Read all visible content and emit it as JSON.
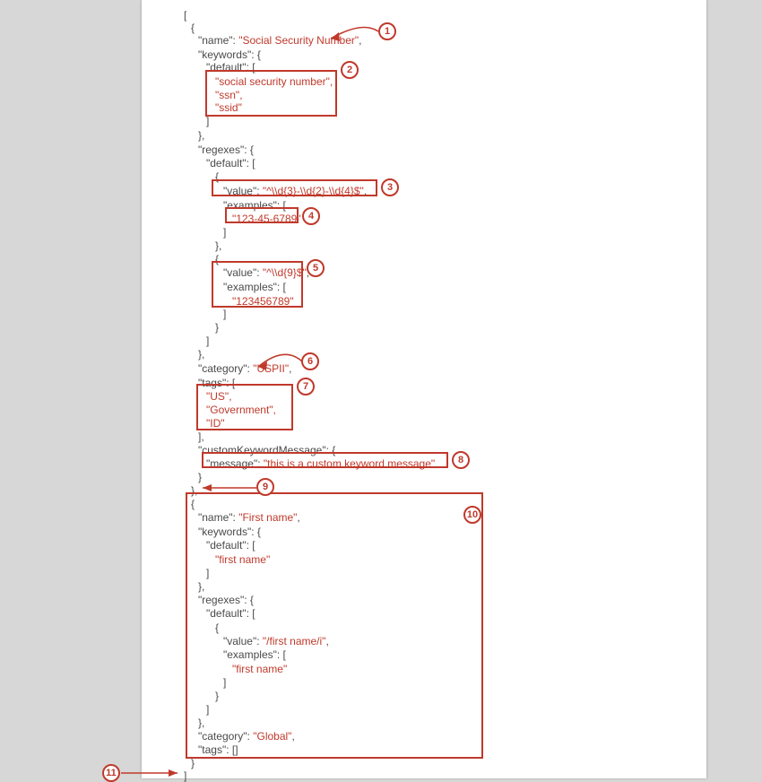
{
  "code": {
    "l1": "[",
    "l2": "{",
    "l3a": "\"name\"",
    "l3b": ": ",
    "l3c": "\"Social Security Number\"",
    "l3d": ",",
    "l4a": "\"keywords\"",
    "l4b": ": {",
    "l5a": "\"default\"",
    "l5b": ": [",
    "l6": "\"social security number\",",
    "l7": "\"ssn\",",
    "l8": "\"ssid\"",
    "l9": "]",
    "l10": "},",
    "l11a": "\"regexes\"",
    "l11b": ": {",
    "l12a": "\"default\"",
    "l12b": ": [",
    "l13": "{",
    "l14a": "\"value\"",
    "l14b": ": ",
    "l14c": "\"^\\\\d{3}-\\\\d{2}-\\\\d{4}$\"",
    "l14d": ",",
    "l15a": "\"examples\"",
    "l15b": ": [",
    "l16": "\"123-45-6789\"",
    "l17": "]",
    "l18": "},",
    "l19": "{",
    "l20a": "\"value\"",
    "l20b": ": ",
    "l20c": "\"^\\\\d{9}$\"",
    "l20d": ",",
    "l21a": "\"examples\"",
    "l21b": ": [",
    "l22": "\"123456789\"",
    "l23": "]",
    "l24": "}",
    "l25": "]",
    "l26": "},",
    "l27a": "\"category\"",
    "l27b": ": ",
    "l27c": "\"USPII\"",
    "l27d": ",",
    "l28a": "\"tags\"",
    "l28b": ": [",
    "l29": "\"US\",",
    "l30": "\"Government\",",
    "l31": "\"ID\"",
    "l32": "],",
    "l33a": "\"customKeywordMessage\"",
    "l33b": ": {",
    "l34a": "\"message\"",
    "l34b": ": ",
    "l34c": "\"this is a custom keyword message\"",
    "l35": "}",
    "l36": "},",
    "l37": "{",
    "l38a": "\"name\"",
    "l38b": ": ",
    "l38c": "\"First name\"",
    "l38d": ",",
    "l39a": "\"keywords\"",
    "l39b": ": {",
    "l40a": "\"default\"",
    "l40b": ": [",
    "l41": "\"first name\"",
    "l42": "]",
    "l43": "},",
    "l44a": "\"regexes\"",
    "l44b": ": {",
    "l45a": "\"default\"",
    "l45b": ": [",
    "l46": "{",
    "l47a": "\"value\"",
    "l47b": ": ",
    "l47c": "\"/first name/i\"",
    "l47d": ",",
    "l48a": "\"examples\"",
    "l48b": ": [",
    "l49": "\"first name\"",
    "l50": "]",
    "l51": "}",
    "l52": "]",
    "l53": "},",
    "l54a": "\"category\"",
    "l54b": ": ",
    "l54c": "\"Global\"",
    "l54d": ",",
    "l55a": "\"tags\"",
    "l55b": ": []",
    "l56": "}",
    "l57": "]"
  },
  "callouts": {
    "c1": "1",
    "c2": "2",
    "c3": "3",
    "c4": "4",
    "c5": "5",
    "c6": "6",
    "c7": "7",
    "c8": "8",
    "c9": "9",
    "c10": "10",
    "c11": "11"
  }
}
